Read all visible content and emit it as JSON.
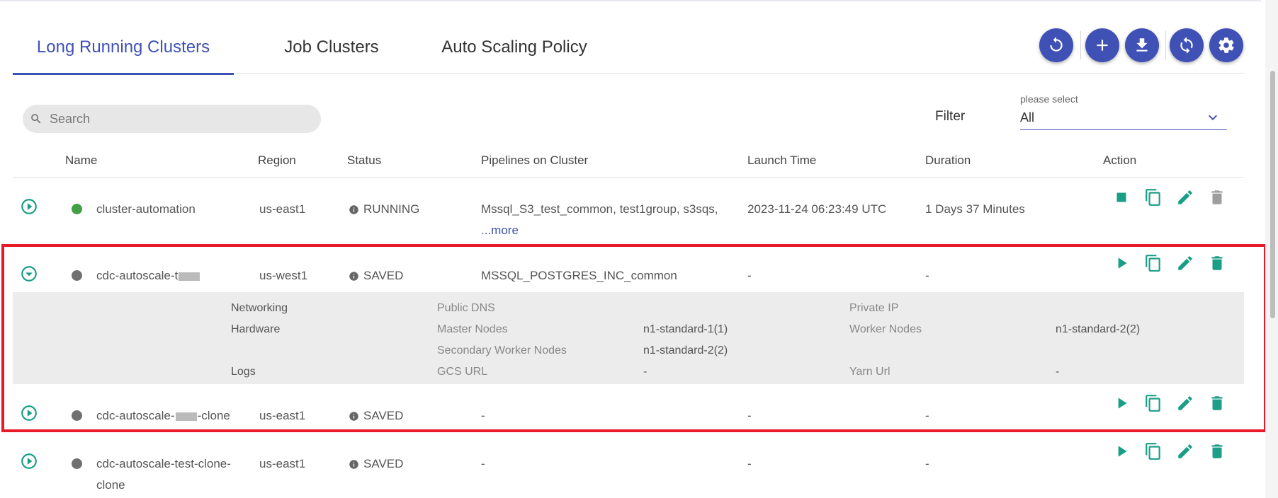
{
  "tabs": [
    {
      "label": "Long Running Clusters",
      "active": true
    },
    {
      "label": "Job Clusters",
      "active": false
    },
    {
      "label": "Auto Scaling Policy",
      "active": false
    }
  ],
  "toolbar": {
    "buttons": [
      "refresh-icon",
      "add-icon",
      "download-icon",
      "sync-icon",
      "settings-icon"
    ]
  },
  "search": {
    "placeholder": "Search",
    "value": ""
  },
  "filter": {
    "label": "Filter",
    "hint": "please select",
    "value": "All"
  },
  "table": {
    "headers": [
      "Name",
      "Region",
      "Status",
      "Pipelines on Cluster",
      "Launch Time",
      "Duration",
      "Action"
    ],
    "rows": [
      {
        "name": "cluster-automation",
        "region": "us-east1",
        "status": "RUNNING",
        "pipelines": "Mssql_S3_test_common, test1group, s3sqs,",
        "more": "...more",
        "launch_time": "2023-11-24 06:23:49 UTC",
        "duration": "1 Days 37 Minutes",
        "status_color": "#43a047"
      },
      {
        "name_prefix": "cdc-autoscale-t",
        "name_suffix": "",
        "region": "us-west1",
        "status": "SAVED",
        "pipelines": "MSSQL_POSTGRES_INC_common",
        "launch_time": "-",
        "duration": "-",
        "status_color": "#707070"
      },
      {
        "name_prefix": "cdc-autoscale-",
        "name_suffix": "-clone",
        "region": "us-east1",
        "status": "SAVED",
        "pipelines": "-",
        "launch_time": "-",
        "duration": "-",
        "status_color": "#707070"
      },
      {
        "name_line1": "cdc-autoscale-test-clone-",
        "name_line2": "clone",
        "region": "us-east1",
        "status": "SAVED",
        "pipelines": "-",
        "launch_time": "-",
        "duration": "-",
        "status_color": "#707070"
      }
    ]
  },
  "detail": {
    "networking": "Networking",
    "public_dns": "Public DNS",
    "private_ip": "Private IP",
    "hardware": "Hardware",
    "master_nodes": "Master Nodes",
    "master_nodes_value": "n1-standard-1(1)",
    "worker_nodes": "Worker Nodes",
    "worker_nodes_value": "n1-standard-2(2)",
    "secondary_worker_nodes": "Secondary Worker Nodes",
    "secondary_worker_nodes_value": "n1-standard-2(2)",
    "logs": "Logs",
    "gcs_url": "GCS URL",
    "gcs_url_value": "-",
    "yarn_url": "Yarn Url",
    "yarn_url_value": "-"
  },
  "colors": {
    "primary": "#3f51b5",
    "action": "#1a9e86",
    "highlight": "#e81a27"
  }
}
